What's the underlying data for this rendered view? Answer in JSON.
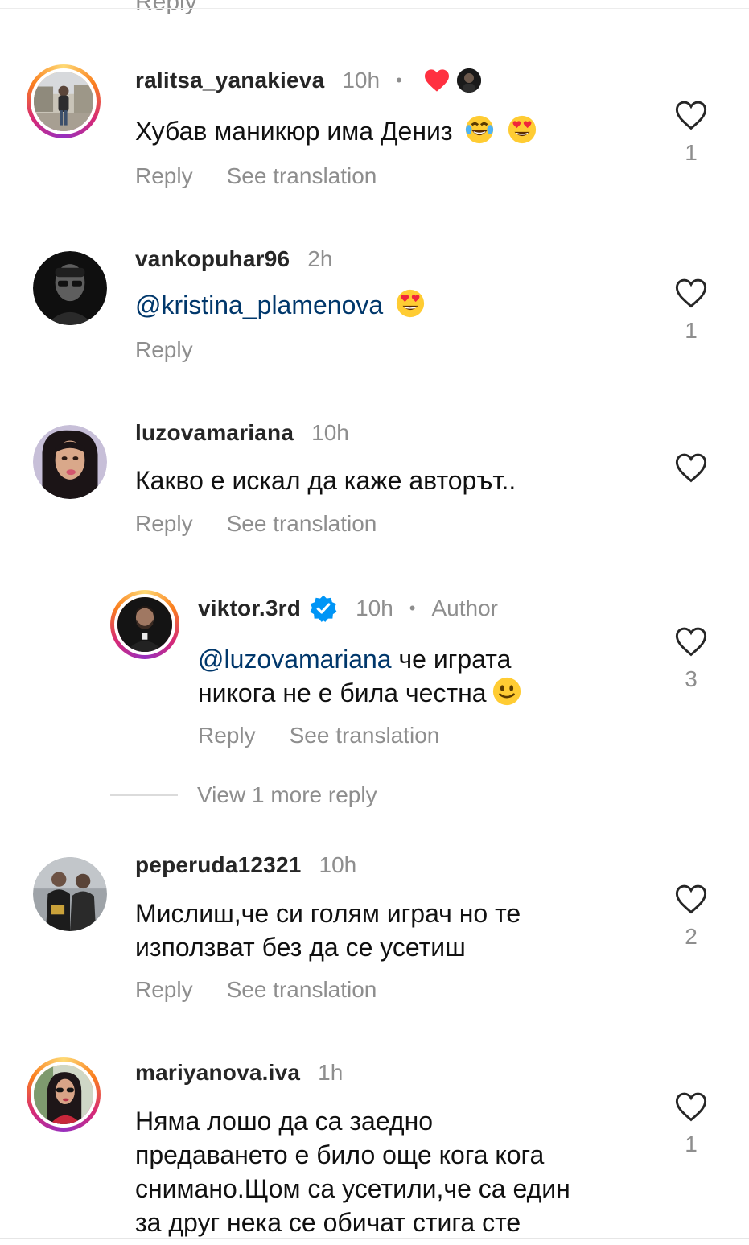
{
  "comments": [
    {
      "username": "ralitsa_yanakieva",
      "time": "10h",
      "dot": "•",
      "text": "Хубав маникюр има Дениз",
      "emojis": [
        "face-with-tears-of-joy",
        "smiling-face-with-heart-eyes"
      ],
      "reply": "Reply",
      "see_translation": "See translation",
      "likes": "1",
      "liked_by_author": true
    },
    {
      "username": "vankopuhar96",
      "time": "2h",
      "mention": "@kristina_plamenova",
      "emojis": [
        "smiling-face-with-heart-eyes"
      ],
      "reply": "Reply",
      "likes": "1"
    },
    {
      "username": "luzovamariana",
      "time": "10h",
      "text": "Какво е искал да каже авторът..",
      "reply": "Reply",
      "see_translation": "See translation",
      "likes": ""
    },
    {
      "username": "viktor.3rd",
      "verified": true,
      "time": "10h",
      "dot": "•",
      "author_label": "Author",
      "mention": "@luzovamariana",
      "text_line1": " че играта",
      "text_line2": "никога не е била честна",
      "emojis": [
        "slightly-smiling-face"
      ],
      "reply": "Reply",
      "see_translation": "See translation",
      "likes": "3"
    },
    {
      "username": "peperuda12321",
      "time": "10h",
      "text_line1": "Мислиш,че си голям играч но те",
      "text_line2": "използват без да се усетиш",
      "reply": "Reply",
      "see_translation": "See translation",
      "likes": "2"
    },
    {
      "username": "mariyanova.iva",
      "time": "1h",
      "text_line1": "Няма лошо да са заедно",
      "text_line2": "предаването е било още кога кога",
      "text_line3": "снимано.Щом са усетили,че са един",
      "text_line4": "за друг нека се обичат стига сте",
      "likes": "1"
    }
  ],
  "view_more_replies": "View 1 more reply",
  "top_cut_text": "Reply",
  "icons": {
    "like": "heart-outline-icon",
    "verified": "verified-badge-icon",
    "liked": "red-heart-icon"
  },
  "colors": {
    "mention": "#00376b",
    "secondary_text": "#8e8e8e",
    "verified": "#0095f6",
    "liked_heart": "#ff3040"
  }
}
